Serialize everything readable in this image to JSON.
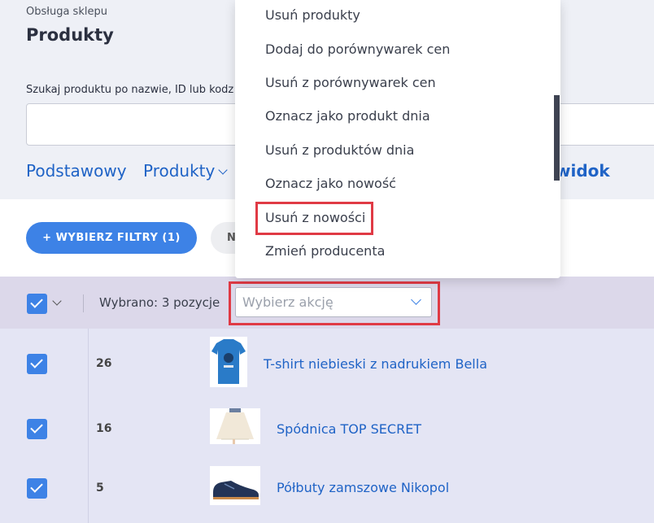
{
  "header": {
    "breadcrumb": "Obsługa sklepu",
    "title": "Produkty",
    "search_label": "Szukaj produktu po nazwie, ID lub kodz",
    "search_value": ""
  },
  "tabs": [
    {
      "label": "Podstawowy"
    },
    {
      "label": "Produkty"
    },
    {
      "label": "widok"
    }
  ],
  "filters": {
    "primary_label": "+ WYBIERZ FILTRY (1)",
    "secondary_label": "N"
  },
  "action_bar": {
    "selected_text": "Wybrano: 3 pozycje",
    "action_placeholder": "Wybierz akcję"
  },
  "dropdown": {
    "items": [
      "Usuń produkty",
      "Dodaj do porównywarek cen",
      "Usuń z porównywarek cen",
      "Oznacz jako produkt dnia",
      "Usuń z produktów dnia",
      "Oznacz jako nowość",
      "Usuń z nowości",
      "Zmień producenta"
    ],
    "highlighted": "Usuń z nowości"
  },
  "products": [
    {
      "id": "26",
      "name": "T-shirt niebieski z nadrukiem Bella",
      "thumb": "blue-tshirt"
    },
    {
      "id": "16",
      "name": "Spódnica TOP SECRET",
      "thumb": "white-skirt"
    },
    {
      "id": "5",
      "name": "Półbuty zamszowe Nikopol",
      "thumb": "navy-shoe"
    }
  ],
  "colors": {
    "accent": "#3d82e6",
    "link": "#1f63c6",
    "highlight": "#e03a45",
    "selection_bar": "#dcd8ea"
  }
}
